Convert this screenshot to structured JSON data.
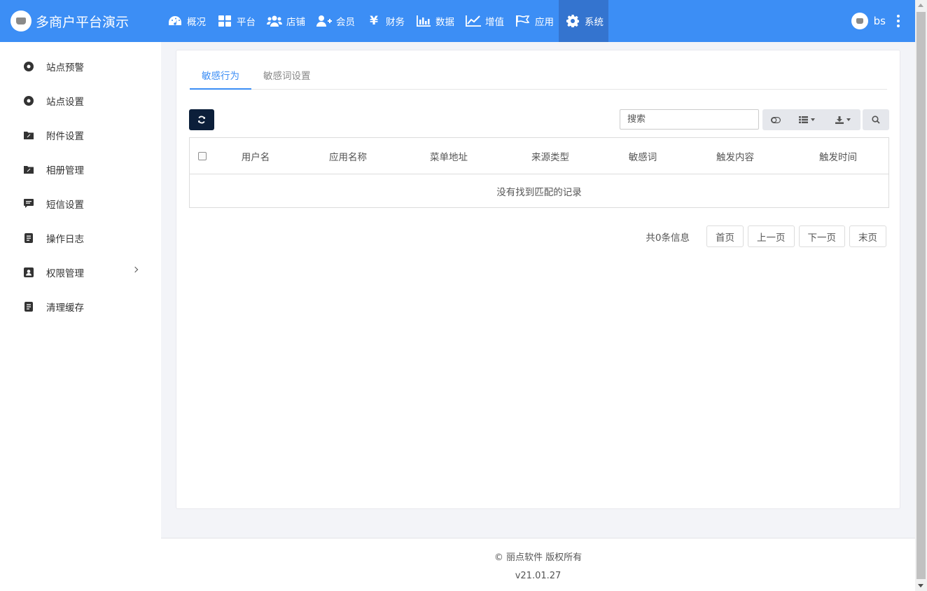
{
  "brand": {
    "title": "多商户平台演示"
  },
  "nav": [
    {
      "label": "概况",
      "icon": "dashboard-icon"
    },
    {
      "label": "平台",
      "icon": "grid-icon"
    },
    {
      "label": "店铺",
      "icon": "users-icon"
    },
    {
      "label": "会员",
      "icon": "user-plus-icon"
    },
    {
      "label": "财务",
      "icon": "yen-icon"
    },
    {
      "label": "数据",
      "icon": "bar-chart-icon"
    },
    {
      "label": "增值",
      "icon": "line-chart-icon"
    },
    {
      "label": "应用",
      "icon": "flag-icon"
    },
    {
      "label": "系统",
      "icon": "gear-icon",
      "active": true
    }
  ],
  "user": {
    "name": "bs"
  },
  "sidebar": {
    "items": [
      {
        "label": "站点预警",
        "icon": "circle-dot-icon"
      },
      {
        "label": "站点设置",
        "icon": "circle-dot-icon"
      },
      {
        "label": "附件设置",
        "icon": "folder-icon"
      },
      {
        "label": "相册管理",
        "icon": "folder-icon"
      },
      {
        "label": "短信设置",
        "icon": "message-icon"
      },
      {
        "label": "操作日志",
        "icon": "file-text-icon"
      },
      {
        "label": "权限管理",
        "icon": "user-badge-icon",
        "has_children": true
      },
      {
        "label": "清理缓存",
        "icon": "file-text-icon"
      }
    ]
  },
  "tabs": [
    {
      "label": "敏感行为",
      "active": true
    },
    {
      "label": "敏感词设置"
    }
  ],
  "toolbar": {
    "search_placeholder": "搜索"
  },
  "table": {
    "columns": [
      "用户名",
      "应用名称",
      "菜单地址",
      "来源类型",
      "敏感词",
      "触发内容",
      "触发时间"
    ],
    "empty_text": "没有找到匹配的记录"
  },
  "pagination": {
    "info": "共0条信息",
    "first": "首页",
    "prev": "上一页",
    "next": "下一页",
    "last": "末页"
  },
  "footer": {
    "copyright": "© 丽点软件 版权所有",
    "version": "v21.01.27"
  },
  "colors": {
    "topbar": "#3c8ef5",
    "topbar_active": "#3474cf",
    "refresh_button": "#0c1f3a",
    "tab_active": "#3c8ef5"
  }
}
